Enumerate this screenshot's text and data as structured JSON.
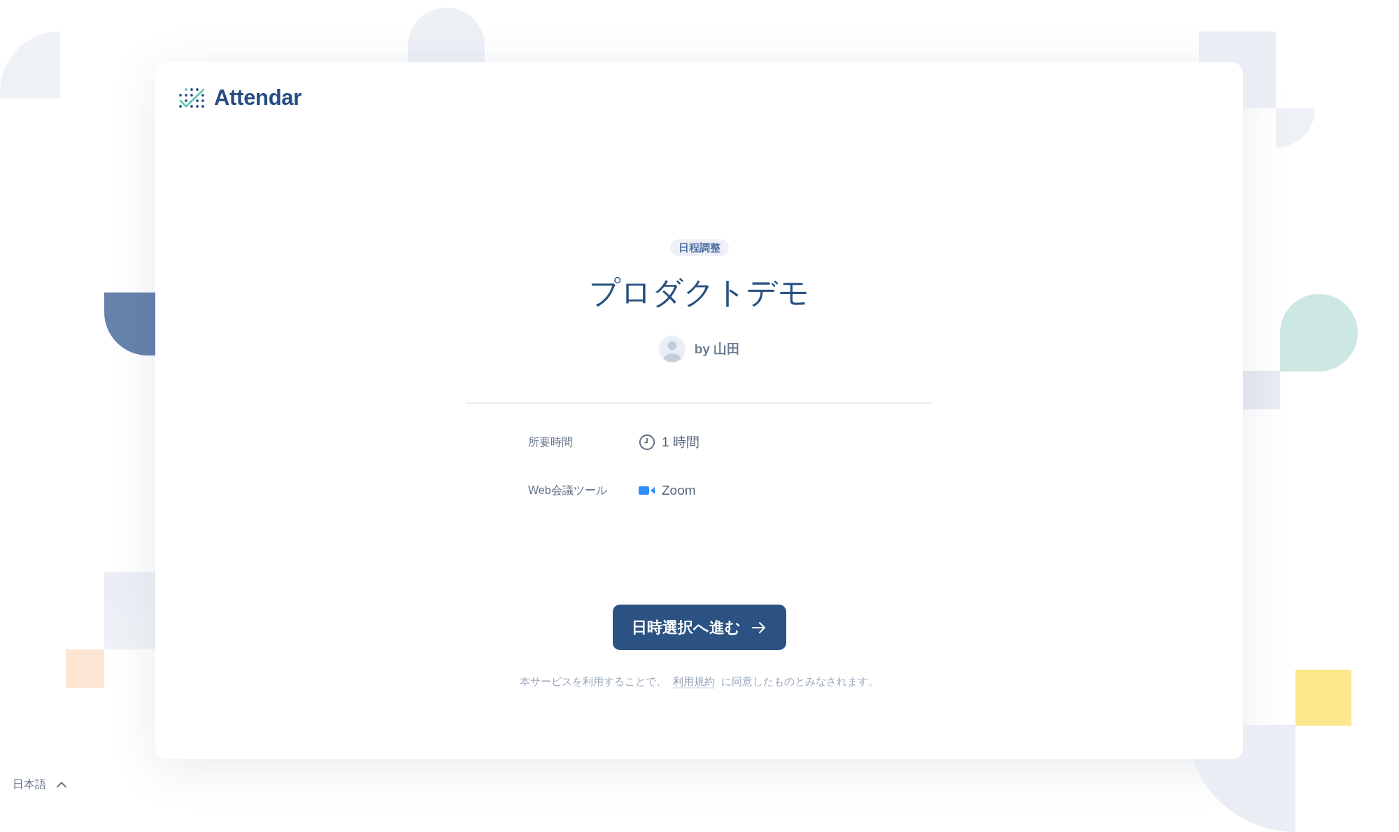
{
  "logo": {
    "text": "Attendar"
  },
  "event": {
    "badge": "日程調整",
    "title": "プロダクトデモ",
    "host": "by 山田"
  },
  "details": [
    {
      "kind": "duration",
      "label": "所要時間",
      "value": "1 時間"
    },
    {
      "kind": "video",
      "label": "Web会議ツール",
      "value": "Zoom"
    }
  ],
  "primary_button": {
    "label": "日時選択へ進む"
  },
  "terms": {
    "before": "本サービスを利用することで、",
    "link": "利用規約",
    "after": "に同意したものとみなされます。"
  },
  "language": {
    "label": "日本語"
  }
}
